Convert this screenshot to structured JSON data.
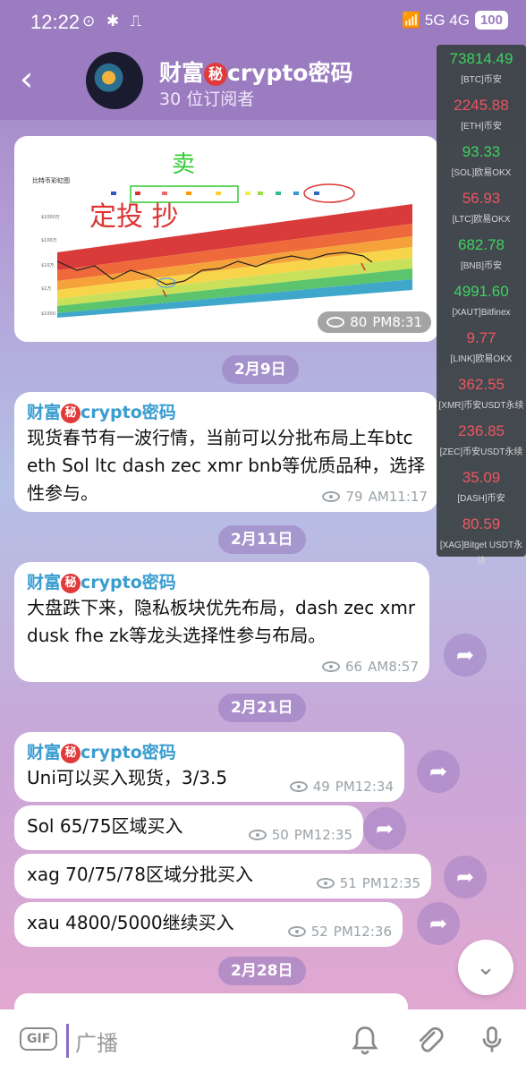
{
  "status_bar": {
    "time": "12:22",
    "left_icons": "⊙ ✱ ⎍",
    "right_icons": "📶 5G 4G",
    "battery": "100"
  },
  "header": {
    "back_icon": "back-arrow-icon",
    "title_prefix": "财富",
    "title_secret": "秘",
    "title_suffix": "crypto密码",
    "subscribers": "30 位订阅者"
  },
  "ticker": [
    {
      "value": "73814.49",
      "color": "#39d65a",
      "label": "[BTC]币安"
    },
    {
      "value": "2245.88",
      "color": "#f2525a",
      "label": "[ETH]币安"
    },
    {
      "value": "93.33",
      "color": "#39d65a",
      "label": "[SOL]欧易OKX"
    },
    {
      "value": "56.93",
      "color": "#f2525a",
      "label": "[LTC]欧易OKX"
    },
    {
      "value": "682.78",
      "color": "#39d65a",
      "label": "[BNB]币安"
    },
    {
      "value": "4991.60",
      "color": "#39d65a",
      "label": "[XAUT]Bitfinex"
    },
    {
      "value": "9.77",
      "color": "#f2525a",
      "label": "[LINK]欧易OKX"
    },
    {
      "value": "362.55",
      "color": "#f2525a",
      "label": "[XMR]币安USDT永续"
    },
    {
      "value": "236.85",
      "color": "#f2525a",
      "label": "[ZEC]币安USDT永续"
    },
    {
      "value": "35.09",
      "color": "#f2525a",
      "label": "[DASH]币安"
    },
    {
      "value": "80.59",
      "color": "#f2525a",
      "label": "[XAG]Bitget USDT永续"
    }
  ],
  "chart_message": {
    "chart_title": "比特币彩虹图",
    "annotation_top": "卖",
    "annotation_main": "定投 抄",
    "views": "80",
    "time": "PM8:31"
  },
  "dates": [
    "2月9日",
    "2月11日",
    "2月21日",
    "2月28日"
  ],
  "messages": [
    {
      "sender": "财富",
      "secret": "秘",
      "sender_suffix": "crypto密码",
      "text": "现货春节有一波行情，当前可以分批布局上车btc eth Sol ltc dash zec xmr bnb等优质品种，选择性参与。",
      "views": "79",
      "time": "AM11:17"
    },
    {
      "sender": "财富",
      "secret": "秘",
      "sender_suffix": "crypto密码",
      "text": "大盘跌下来，隐私板块优先布局，dash zec xmr dusk fhe zk等龙头选择性参与布局。",
      "views": "66",
      "time": "AM8:57"
    },
    {
      "sender": "财富",
      "secret": "秘",
      "sender_suffix": "crypto密码",
      "text": "Uni可以买入现货，3/3.5",
      "views": "49",
      "time": "PM12:34"
    },
    {
      "text": "Sol 65/75区域买入",
      "views": "50",
      "time": "PM12:35"
    },
    {
      "text": "xag 70/75/78区域分批买入",
      "views": "51",
      "time": "PM12:35"
    },
    {
      "text": "xau 4800/5000继续买入",
      "views": "52",
      "time": "PM12:36"
    }
  ],
  "bottom_bar": {
    "gif_label": "GIF",
    "input_placeholder": "广播",
    "icons": [
      "bell-icon",
      "paperclip-icon",
      "microphone-icon"
    ]
  }
}
